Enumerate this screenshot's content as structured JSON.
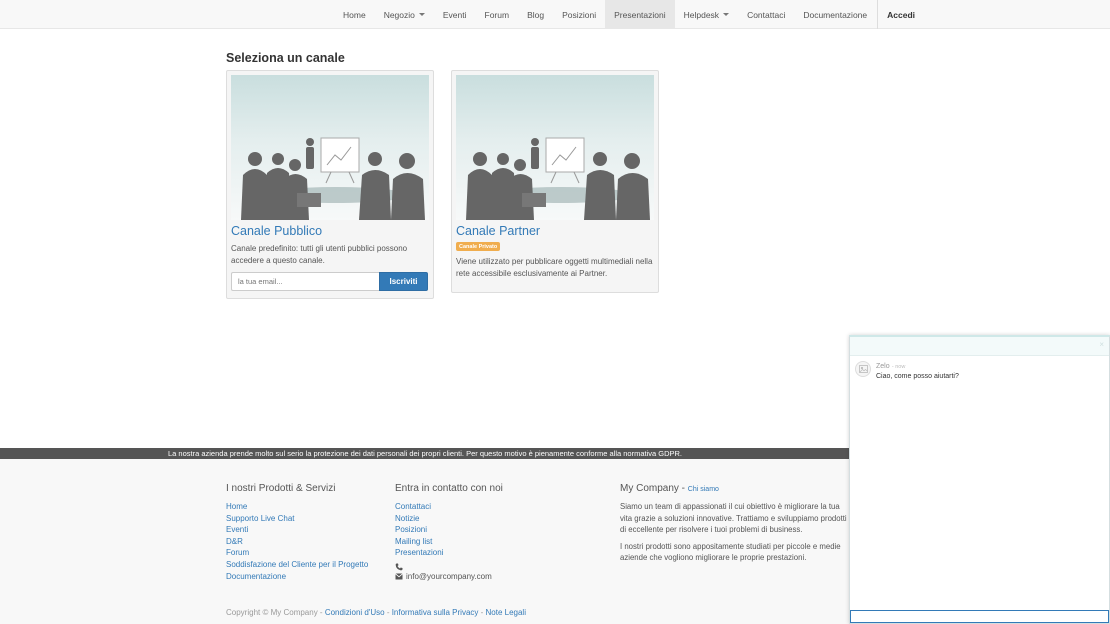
{
  "nav": {
    "items": [
      {
        "label": "Home",
        "dropdown": false
      },
      {
        "label": "Negozio",
        "dropdown": true
      },
      {
        "label": "Eventi",
        "dropdown": false
      },
      {
        "label": "Forum",
        "dropdown": false
      },
      {
        "label": "Blog",
        "dropdown": false
      },
      {
        "label": "Posizioni",
        "dropdown": false
      },
      {
        "label": "Presentazioni",
        "dropdown": false,
        "active": true
      },
      {
        "label": "Helpdesk",
        "dropdown": true
      },
      {
        "label": "Contattaci",
        "dropdown": false
      },
      {
        "label": "Documentazione",
        "dropdown": false
      }
    ],
    "login_label": "Accedi"
  },
  "page": {
    "title": "Seleziona un canale"
  },
  "channels": [
    {
      "title": "Canale Pubblico",
      "description": "Canale predefinito: tutti gli utenti pubblici possono accedere a questo canale.",
      "email_placeholder": "la tua email...",
      "subscribe_label": "Iscriviti"
    },
    {
      "title": "Canale Partner",
      "badge": "Canale Privato",
      "description": "Viene utilizzato per pubblicare oggetti multimediali nella rete accessibile esclusivamente ai Partner."
    }
  ],
  "gdpr_notice": "La nostra azienda prende molto sul serio la protezione dei dati personali dei propri clienti. Per questo motivo è pienamente conforme alla normativa GDPR.",
  "footer": {
    "products": {
      "heading": "I nostri Prodotti & Servizi",
      "links": [
        "Home",
        "Supporto Live Chat",
        "Eventi",
        "D&R",
        "Forum",
        "Soddisfazione del Cliente per il Progetto",
        "Documentazione"
      ]
    },
    "contact": {
      "heading": "Entra in contatto con noi",
      "links": [
        "Contattaci",
        "Notizie",
        "Posizioni",
        "Mailing list",
        "Presentazioni"
      ],
      "phone": "",
      "email": "info@yourcompany.com"
    },
    "company": {
      "heading": "My Company",
      "about_link": "Chi siamo",
      "paragraph1": "Siamo un team di appassionati il cui obiettivo è migliorare la tua vita grazie a soluzioni innovative. Trattiamo e sviluppiamo prodotti di eccellente per risolvere i tuoi problemi di business.",
      "paragraph2": "I nostri prodotti sono appositamente studiati per piccole e medie aziende che vogliono migliorare le proprie prestazioni."
    },
    "copyright": "Copyright © My Company",
    "legal_links": [
      "Condizioni d'Uso",
      "Informativa sulla Privacy",
      "Note Legali"
    ]
  },
  "chat": {
    "author": "Zelo",
    "time": "now",
    "message": "Ciao, come posso aiutarti?",
    "close_symbol": "×"
  }
}
